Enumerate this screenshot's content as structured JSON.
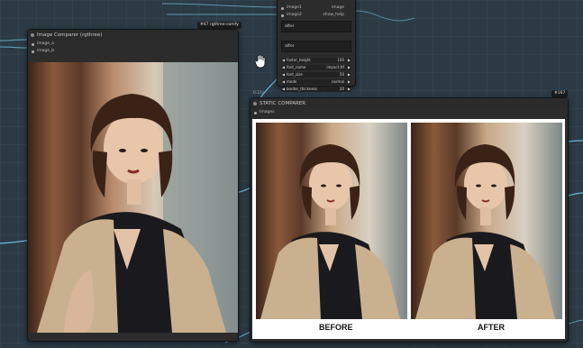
{
  "top_node": {
    "inputs": [
      "image1",
      "image2"
    ],
    "outputs": [
      "image",
      "show_help"
    ],
    "text_a": "after",
    "text_b": "after",
    "widgets": [
      {
        "label": "footer_height",
        "value": "100"
      },
      {
        "label": "font_name",
        "value": "impact.ttf"
      },
      {
        "label": "font_size",
        "value": "50"
      },
      {
        "label": "mode",
        "value": "normal"
      },
      {
        "label": "border_thickness",
        "value": "20"
      }
    ]
  },
  "left_node": {
    "badge": "#47 rgthree-comfy",
    "title": "Image Comparer (rgthree)",
    "inputs": [
      "image_a",
      "image_b"
    ]
  },
  "right_node": {
    "badge": "#167",
    "id_label": "0.21s",
    "title": "STATIC COMPARER",
    "inputs": [
      "Images"
    ],
    "before_label": "BEFORE",
    "after_label": "AFTER"
  },
  "colors": {
    "canvas": "#2b3a44",
    "node_body": "#2c2c2c",
    "wire": "#7fd8ff"
  }
}
